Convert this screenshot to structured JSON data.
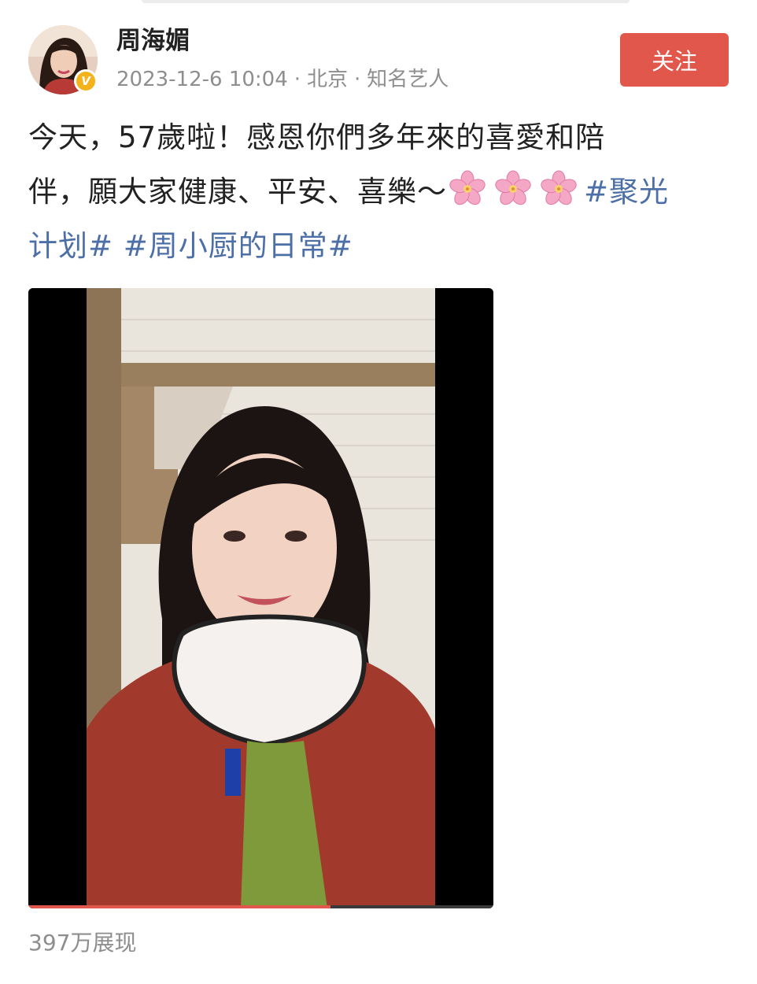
{
  "header": {
    "username": "周海媚",
    "verified_badge": "V",
    "timestamp": "2023-12-6 10:04",
    "location": "北京",
    "separator": "·",
    "tag": "知名艺人",
    "follow_label": "关注"
  },
  "post": {
    "line1": "今天，57歲啦！感恩你們多年來的喜愛和陪",
    "line2_text": "伴，願大家健康、平安、喜樂～",
    "line2_emoji": "cherry-blossom-icon",
    "line2_emoji_count": 3,
    "hashtag_1_part1": "#聚光",
    "hashtag_1_part2": "计划#",
    "hashtag_2": "#周小厨的日常#"
  },
  "video": {
    "progress": 0.65,
    "progress_color": "#e2574c"
  },
  "footer": {
    "views": "397万展现"
  },
  "colors": {
    "follow_button": "#e2574c",
    "hashtag": "#4d6fa8",
    "meta_text": "#8e8e8e",
    "verified": "#f4b21b"
  }
}
